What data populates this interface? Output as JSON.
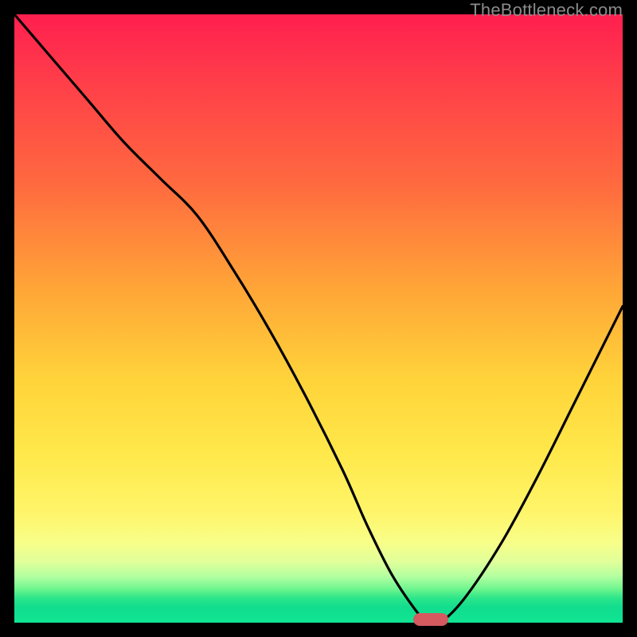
{
  "attribution": "TheBottleneck.com",
  "colors": {
    "frame_background": "#000000",
    "attribution_text": "#8b8b8b",
    "curve_stroke": "#000000",
    "marker_fill": "#d45a5f",
    "gradient_top": "#ff1f4f",
    "gradient_bottom": "#0fe593"
  },
  "chart_data": {
    "type": "line",
    "title": "",
    "xlabel": "",
    "ylabel": "",
    "xlim": [
      0,
      100
    ],
    "ylim": [
      0,
      100
    ],
    "series": [
      {
        "name": "bottleneck-curve",
        "x": [
          0,
          6,
          12,
          18,
          24,
          30,
          36,
          42,
          48,
          54,
          58,
          62,
          66,
          68,
          70,
          74,
          80,
          86,
          92,
          98,
          100
        ],
        "values": [
          100,
          93,
          86,
          79,
          73,
          67,
          58,
          48,
          37,
          25,
          16,
          8,
          2,
          0,
          0,
          4,
          13,
          24,
          36,
          48,
          52
        ]
      }
    ],
    "annotations": [
      {
        "name": "optimal-marker",
        "x": 68.5,
        "y": 0.5,
        "shape": "rounded-pill"
      }
    ],
    "background": "vertical-heat-gradient"
  }
}
